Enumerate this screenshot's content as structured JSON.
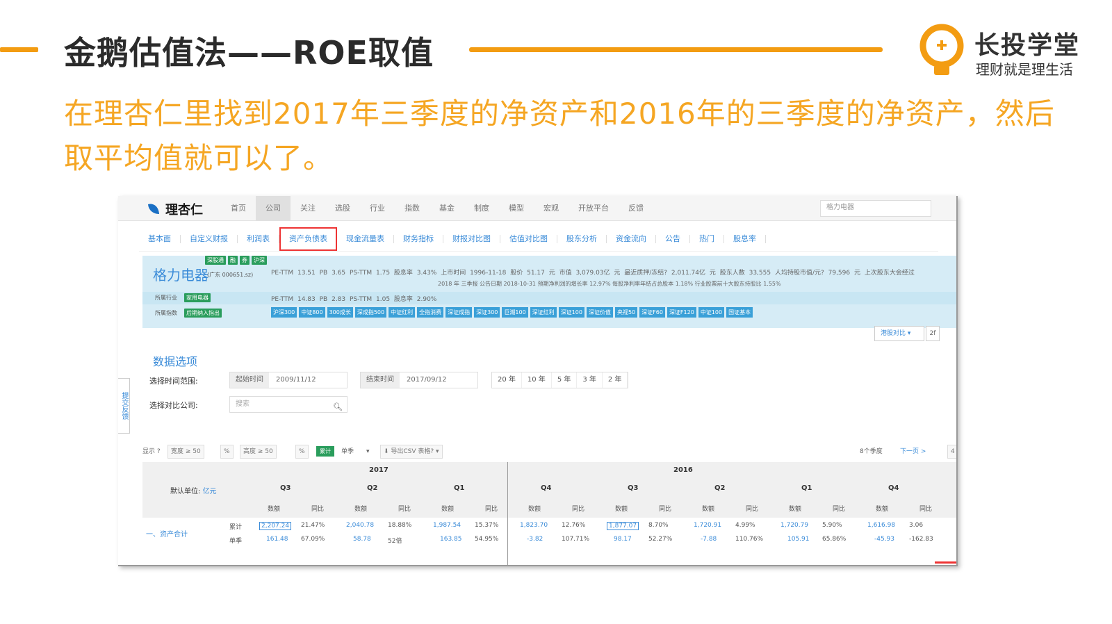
{
  "slide": {
    "title": "金鹅估值法——ROE取值",
    "body": "在理杏仁里找到2017年三季度的净资产和2016年的三季度的净资产，然后取平均值就可以了。",
    "accent_color": "#f39c12",
    "body_color": "#f5a623"
  },
  "logo": {
    "name": "长投学堂",
    "slogan": "理财就是理生活",
    "icon": "lightbulb-icon"
  },
  "app": {
    "brand": "理杏仁",
    "nav": [
      "首页",
      "公司",
      "关注",
      "选股",
      "行业",
      "指数",
      "基金",
      "制度",
      "模型",
      "宏观",
      "开放平台",
      "反馈"
    ],
    "active_nav": "公司",
    "search_placeholder": "格力电器"
  },
  "subnav": [
    "基本面",
    "自定义财报",
    "利润表",
    "资产负债表",
    "现金流量表",
    "财务指标",
    "财报对比图",
    "估值对比图",
    "股东分析",
    "资金流向",
    "公告",
    "热门",
    "股息率"
  ],
  "company": {
    "name": "格力电器",
    "code": "(广东 000651.sz)",
    "badges": [
      "深股通",
      "融",
      "券",
      "沪深"
    ],
    "metrics1": "PE-TTM 13.51   PB 3.65   PS-TTM 1.75   股息率 3.43%   上市时间 1996-11-18   股价 51.17 元   市值 3,079.03亿 元   最近质押/冻结? 2,011.74亿 元   股东人数 33,555   人均持股市值/元? 79,596 元   上次股东大会经过",
    "metrics2": "2018 年 三季报 公告日期 2018-10-31   预期净利润的增长率 12.97%   每股净利率年结占总股本 1.18%   行业股票前十大股东持股比 1.55%",
    "industry_label": "所属行业",
    "industry_badge": "家用电器",
    "row2_metrics": "PE-TTM 14.83   PB 2.83   PS-TTM 1.05   股息率 2.90%",
    "index_label": "所属指数",
    "index_badge": "后期纳入指出",
    "indices": [
      "沪深300",
      "中证800",
      "300成长",
      "深成指500",
      "中证红利",
      "全指消费",
      "深证成指",
      "深证300",
      "巨潮100",
      "深证红利",
      "深证100",
      "深证价值",
      "央视50",
      "深证F60",
      "深证F120",
      "中证100",
      "国证基本"
    ]
  },
  "dropdown": {
    "label": "港股对比 ▾",
    "extra": "2f"
  },
  "side_tab": "提交反馈",
  "options": {
    "title": "数据选项",
    "range_label": "选择时间范围:",
    "start_label": "起始时间",
    "start_value": "2009/11/12",
    "end_label": "结束时间",
    "end_value": "2017/09/12",
    "ranges": [
      "20 年",
      "10 年",
      "5 年",
      "3 年",
      "2 年"
    ],
    "compare_label": "选择对比公司:",
    "compare_placeholder": "搜索"
  },
  "toolbar": {
    "display_label": "显示 ?",
    "width_label": "宽度 ≥",
    "width_value": "50",
    "pct": "%",
    "height_label": "高度 ≥",
    "height_value": "50",
    "accum_label": "累计",
    "quarter_label": "单季",
    "export_label": "⬇ 导出CSV 表格? ▾",
    "per_label": "8个季度",
    "next_label": "下一页 >",
    "extra": "4"
  },
  "table": {
    "unit_label": "默认单位:",
    "unit_value": "亿元",
    "years": [
      "2017",
      "2016"
    ],
    "quarters": [
      "Q3",
      "Q2",
      "Q1",
      "Q4",
      "Q3",
      "Q2",
      "Q1",
      "Q4"
    ],
    "sub_value": "数额",
    "sub_change": "同比",
    "row_name": "一、资产合计",
    "row_kinds": [
      "累计",
      "单季"
    ],
    "cumulative_values": [
      "2,207.24",
      "2,040.78",
      "1,987.54",
      "1,823.70",
      "1,877.07",
      "1,720.91",
      "1,720.79",
      "1,616.98"
    ],
    "cumulative_changes": [
      "21.47%",
      "18.88%",
      "15.37%",
      "12.76%",
      "8.70%",
      "4.99%",
      "5.90%",
      "3.06"
    ],
    "quarterly_values": [
      "161.48",
      "58.78",
      "163.85",
      "-3.82",
      "98.17",
      "-7.88",
      "105.91",
      "-45.93"
    ],
    "quarterly_changes": [
      "67.09%",
      "52倍",
      "54.95%",
      "107.71%",
      "52.27%",
      "110.76%",
      "65.86%",
      "-162.83"
    ]
  }
}
